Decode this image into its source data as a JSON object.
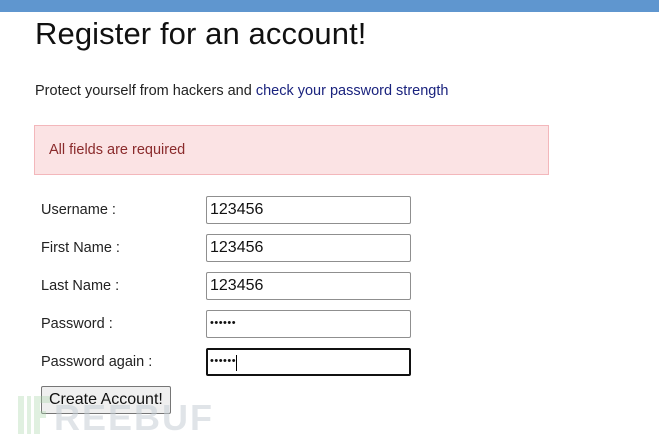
{
  "page": {
    "title": "Register for an account!",
    "intro_text": "Protect yourself from hackers and ",
    "intro_link": "check your password strength"
  },
  "alert": {
    "message": "All fields are required"
  },
  "form": {
    "fields": [
      {
        "label": "Username :",
        "value": "123456",
        "type": "text"
      },
      {
        "label": "First Name :",
        "value": "123456",
        "type": "text"
      },
      {
        "label": "Last Name :",
        "value": "123456",
        "type": "text"
      },
      {
        "label": "Password :",
        "value": "••••••",
        "type": "password"
      },
      {
        "label": "Password again :",
        "value": "••••••",
        "type": "password",
        "focused": true
      }
    ],
    "submit_label": "Create Account!"
  },
  "watermark": {
    "text": "REEBUF"
  },
  "colors": {
    "topbar": "#5f96cf",
    "alert_bg": "#fbe3e4",
    "alert_border": "#f3b7bb",
    "alert_text": "#8a2a2b",
    "link": "#1a237e"
  }
}
